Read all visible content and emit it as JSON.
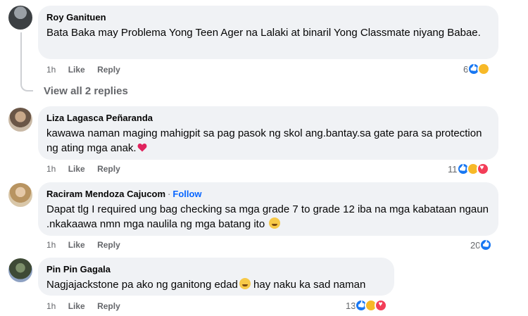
{
  "comments": [
    {
      "name": "Roy Ganituen",
      "text": "Bata Baka may Problema Yong Teen Ager na Lalaki at binaril Yong Classmate niyang Babae.",
      "time": "1h",
      "like": "Like",
      "reply": "Reply",
      "reaction_count": "6",
      "reactions": [
        "like",
        "care"
      ]
    },
    {
      "name": "Liza Lagasca Peñaranda",
      "text": "kawawa naman maging mahigpit sa pag pasok ng skol ang.bantay.sa gate para sa protection ng ating mga anak.",
      "time": "1h",
      "like": "Like",
      "reply": "Reply",
      "reaction_count": "11",
      "reactions": [
        "like",
        "care",
        "love"
      ]
    },
    {
      "name": "Raciram Mendoza Cajucom",
      "follow": "Follow",
      "text": "Dapat tlg I required ung bag checking sa mga grade 7 to grade 12 iba na mga kabataan ngaun .nkakaawa nmn mga naulila ng mga batang ito",
      "time": "1h",
      "like": "Like",
      "reply": "Reply",
      "reaction_count": "20",
      "reactions": [
        "like"
      ]
    },
    {
      "name": "Pin Pin Gagala",
      "text_a": "Nagjajackstone pa ako ng ganitong edad",
      "text_b": " hay naku ka sad naman",
      "time": "1h",
      "like": "Like",
      "reply": "Reply",
      "reaction_count": "13",
      "reactions": [
        "like",
        "haha",
        "love"
      ]
    }
  ],
  "view_replies": "View all 2 replies",
  "dot": "·",
  "colors": {
    "bubble": "#f0f2f5",
    "link": "#0866ff",
    "meta": "#65676b",
    "like": "#1877f2",
    "love": "#f33e58"
  }
}
